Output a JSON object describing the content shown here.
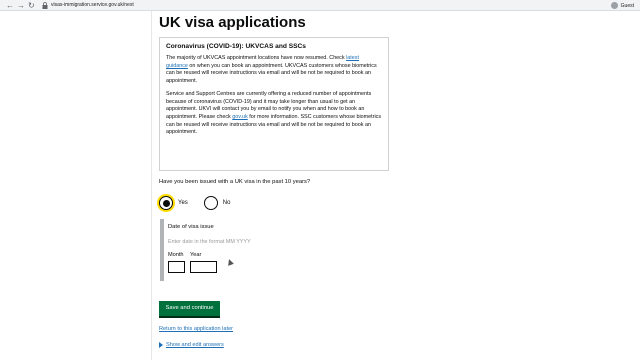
{
  "browser": {
    "url": "visas-immigration.service.gov.uk/next",
    "profile": "Guest"
  },
  "page": {
    "title": "UK visa applications"
  },
  "notice": {
    "heading": "Coronavirus (COVID-19): UKVCAS and SSCs",
    "p1_before": "The majority of UKVCAS appointment locations have now resumed. Check ",
    "p1_link": "latest guidance",
    "p1_after": " on when you can book an appointment. UKVCAS customers whose biometrics can be reused will receive instructions via email and will be not be required to book an appointment.",
    "p2_before": "Service and Support Centres are currently offering a reduced number of appointments because of coronavirus (COVID-19) and it may take longer than usual to get an appointment. UKVI will contact you by email to notify you when and how to book an appointment. Please check ",
    "p2_link": "gov.uk",
    "p2_after": " for more information. SSC customers whose biometrics can be reused will receive instructions via email and will be not be required to book an appointment."
  },
  "form": {
    "question": "Have you been issued with a UK visa in the past 10 years?",
    "yes_label": "Yes",
    "no_label": "No",
    "selected": "Yes",
    "date_label": "Date of visa issue",
    "date_hint": "Enter date in the format MM YYYY",
    "month_label": "Month",
    "year_label": "Year",
    "month_value": "",
    "year_value": ""
  },
  "actions": {
    "save_label": "Save and continue",
    "return_link": "Return to this application later",
    "details_link": "Show and edit answers"
  }
}
